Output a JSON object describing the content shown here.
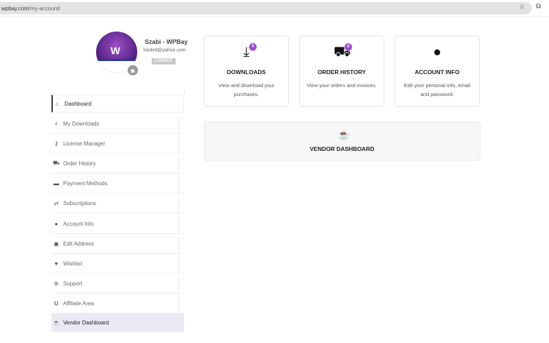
{
  "browser": {
    "domain": "wpbay.com",
    "path": "/my-account/"
  },
  "profile": {
    "name": "Szabi - WPBay",
    "email": "kisded@yahoo.com",
    "logout": "LOGOUT"
  },
  "nav": [
    {
      "label": "Dashboard",
      "icon": "home-icon",
      "glyph": "⌂"
    },
    {
      "label": "My Downloads",
      "icon": "download-icon",
      "glyph": "⤓"
    },
    {
      "label": "License Manager",
      "icon": "key-icon",
      "glyph": "⚷"
    },
    {
      "label": "Order History",
      "icon": "cart-icon",
      "glyph": "🛒"
    },
    {
      "label": "Payment Methods",
      "icon": "credit-card-icon",
      "glyph": "▭"
    },
    {
      "label": "Subscriptions",
      "icon": "retweet-icon",
      "glyph": "⇄"
    },
    {
      "label": "Account Info",
      "icon": "user-icon",
      "glyph": "●"
    },
    {
      "label": "Edit Address",
      "icon": "address-book-icon",
      "glyph": "▣"
    },
    {
      "label": "Wishlist",
      "icon": "heart-icon",
      "glyph": "♥"
    },
    {
      "label": "Support",
      "icon": "life-ring-icon",
      "glyph": "⊛"
    },
    {
      "label": "Affiliate Area",
      "icon": "magnet-icon",
      "glyph": "U"
    },
    {
      "label": "Vendor Dashboard",
      "icon": "coffee-icon",
      "glyph": "☕"
    }
  ],
  "cards": [
    {
      "title": "DOWNLOADS",
      "desc": "View and download your purchases.",
      "badge": "0"
    },
    {
      "title": "ORDER HISTORY",
      "desc": "View your orders and invoices.",
      "badge": "0"
    },
    {
      "title": "ACCOUNT INFO",
      "desc": "Edit your personal info, email and password."
    }
  ],
  "vendor_card": {
    "title": "VENDOR DASHBOARD"
  }
}
